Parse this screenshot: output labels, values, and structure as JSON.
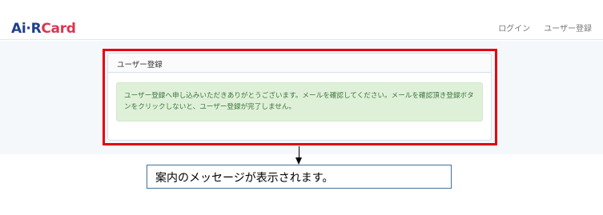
{
  "navbar": {
    "logo_part1": "Ai",
    "logo_dot": "·",
    "logo_part2": "R",
    "logo_part3": "Card",
    "login_link": "ログイン",
    "register_link": "ユーザー登録"
  },
  "panel": {
    "heading": "ユーザー登録",
    "alert_message": "ユーザー登録へ申し込みいただきありがとうございます。メールを確認してください。メールを確認頂き登録ボタンをクリックしないと、ユーザー登録が完了しません。"
  },
  "annotation": {
    "callout_text": "案内のメッセージが表示されます。"
  },
  "colors": {
    "logo_blue": "#1f3f8c",
    "logo_red": "#d9374f",
    "alert_bg": "#dff0d8",
    "alert_text": "#3c763d",
    "highlight_red": "#e60012",
    "callout_border": "#41719c"
  }
}
